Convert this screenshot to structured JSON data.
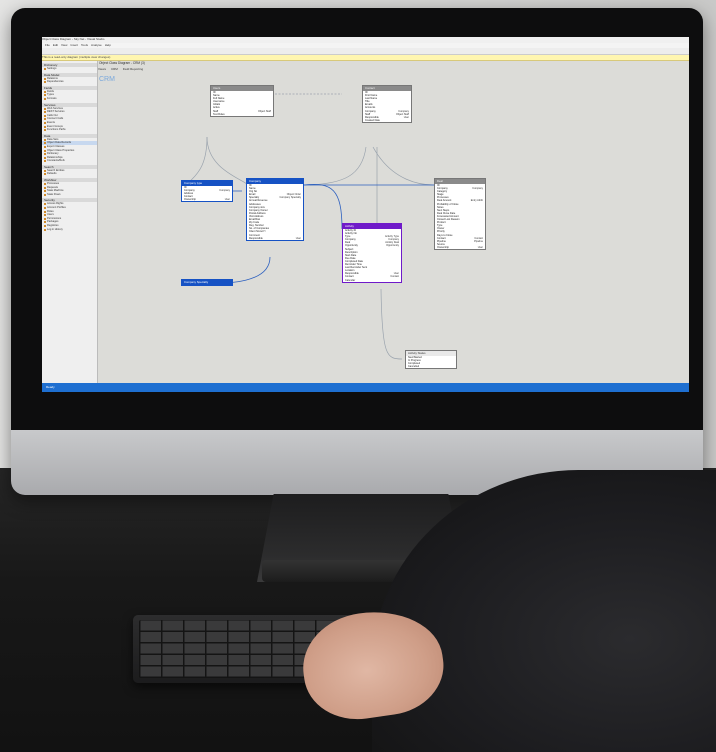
{
  "screen": {
    "title": "Object Class Diagram - Sky Net - Visual Studio",
    "menu": [
      "File",
      "Edit",
      "View",
      "Insert",
      "Tools",
      "Analyse",
      "Help"
    ],
    "infobar": "This is a read-only diagram (multiple view changes)",
    "doc_title": "Object Class Diagram - CRM (3)",
    "tabs": [
      "Views",
      "CRM",
      "Field Reporting"
    ],
    "canvas_title": "CRM",
    "statusbar": "Ready",
    "sidebar": [
      {
        "heading": "Dictionary",
        "items": [
          "Settings"
        ]
      },
      {
        "heading": "Data Model",
        "items": [
          "Relations",
          "Dependencies"
        ]
      },
      {
        "heading": "Fields",
        "items": [
          "Fields",
          "Types",
          "Formats"
        ]
      },
      {
        "heading": "Services",
        "items": [
          "Web Services",
          "REST Services",
          "Calls Out",
          "Connect Calls",
          "Events",
          "Event Groups",
          "Functions Paths"
        ]
      },
      {
        "heading": "Data",
        "items": [
          "Data Sets",
          "Object Data Records",
          "Export Classes",
          "Object Class Properties",
          "Dictionary",
          "Relationships",
          "Constants/Refs"
        ]
      },
      {
        "heading": "Search",
        "items": [
          "Search Entities",
          "Defaults"
        ]
      },
      {
        "heading": "Workflow",
        "items": [
          "Processes",
          "Requests",
          "State Machine",
          "State Flows"
        ]
      },
      {
        "heading": "Security",
        "items": [
          "Access Rights",
          "Account Profiles",
          "Roles",
          "Users",
          "Permissions",
          "Packages",
          "Registries",
          "Log in History"
        ]
      }
    ]
  },
  "boxes": {
    "topleft": {
      "header": "Users",
      "rows": [
        [
          "ID",
          ""
        ],
        [
          "Name",
          ""
        ],
        [
          "Full Name",
          ""
        ],
        [
          "Username",
          ""
        ],
        [
          "Initials",
          ""
        ],
        [
          "Active",
          ""
        ],
        [
          "Staff",
          "Object Staff"
        ],
        [
          "Test Roles",
          ""
        ]
      ]
    },
    "topright": {
      "header": "Contact",
      "rows": [
        [
          "ID",
          ""
        ],
        [
          "First Name",
          ""
        ],
        [
          "Last Name",
          ""
        ],
        [
          "Title",
          ""
        ],
        [
          "Emails",
          ""
        ],
        [
          "Accounts",
          ""
        ],
        [
          "Company",
          "Company"
        ],
        [
          "Staff",
          "Object Staff"
        ],
        [
          "Responsible",
          "User"
        ],
        [
          "Created Date",
          ""
        ]
      ]
    },
    "left": {
      "header": "Company type",
      "rows": [
        [
          "ID",
          ""
        ],
        [
          "Company",
          "Company"
        ],
        [
          "Address",
          ""
        ],
        [
          "Contact",
          ""
        ],
        [
          "Ownership",
          "User"
        ]
      ]
    },
    "center": {
      "header": "Company",
      "rows": [
        [
          "ID",
          ""
        ],
        [
          "Name",
          ""
        ],
        [
          "Org No",
          ""
        ],
        [
          "Email",
          "Object Order"
        ],
        [
          "Specialty",
          "Company Specialty"
        ],
        [
          "Annual Revenue",
          ""
        ],
        [
          "Addresses",
          ""
        ],
        [
          "Company size",
          ""
        ],
        [
          "Company Owner",
          ""
        ],
        [
          "Postal Address",
          ""
        ],
        [
          "Visit Address",
          ""
        ],
        [
          "Email/Fax",
          ""
        ],
        [
          "Zip Code",
          ""
        ],
        [
          "Reg. Number",
          ""
        ],
        [
          "No. of Companies",
          ""
        ],
        [
          "Client Since/Yr",
          ""
        ],
        [
          "Comment",
          ""
        ],
        [
          "Responsible",
          "User"
        ]
      ]
    },
    "bottomleft": {
      "header": "Company Specialty",
      "rows": []
    },
    "right": {
      "header": "Deal",
      "rows": [
        [
          "ID",
          ""
        ],
        [
          "Company",
          "Company"
        ],
        [
          "Category",
          ""
        ],
        [
          "Stage",
          ""
        ],
        [
          "Processes",
          ""
        ],
        [
          "Deal Amount",
          "Entry Attrib"
        ],
        [
          "Probability of Close",
          ""
        ],
        [
          "Notes",
          ""
        ],
        [
          "Next Steps",
          ""
        ],
        [
          "Deal Close Date",
          ""
        ],
        [
          "Forecasted Amount",
          ""
        ],
        [
          "Closed Lost Reason",
          ""
        ],
        [
          "Product",
          ""
        ],
        [
          "Type",
          ""
        ],
        [
          "Owner",
          ""
        ],
        [
          "Priority",
          ""
        ],
        [
          "Days to Close",
          ""
        ],
        [
          "Contact",
          "Contact"
        ],
        [
          "Pipeline",
          "Pipeline"
        ],
        [
          "Source",
          ""
        ],
        [
          "Ownership",
          "User"
        ]
      ]
    },
    "middle": {
      "header": "Activity",
      "rows": [
        [
          "Activity ID",
          ""
        ],
        [
          "Activity No",
          ""
        ],
        [
          "Type",
          "Activity Type"
        ],
        [
          "Company",
          "Company"
        ],
        [
          "Deal",
          "Activity Deal"
        ],
        [
          "Opportunity",
          "Opportunity"
        ],
        [
          "Subject",
          ""
        ],
        [
          "Description",
          ""
        ],
        [
          "Start Date",
          ""
        ],
        [
          "Due Date",
          ""
        ],
        [
          "Completed Date",
          ""
        ],
        [
          "Reminder Time",
          ""
        ],
        [
          "Last Reminder Sent",
          ""
        ],
        [
          "Location",
          ""
        ],
        [
          "Responsible",
          "User"
        ],
        [
          "Contact",
          "Contact"
        ],
        [
          "Calendar",
          ""
        ]
      ]
    },
    "bottomright": {
      "header": "Activity Status",
      "rows": [
        [
          "New/Started",
          ""
        ],
        [
          "In Progress",
          ""
        ],
        [
          "Completed",
          ""
        ],
        [
          "Cancelled",
          ""
        ]
      ]
    }
  },
  "colors": {
    "gray_header": "#8a8a8a",
    "blue_header": "#1652c4",
    "purple_header": "#6f1ac9",
    "status_bar": "#1e6fd1"
  },
  "icons": [
    "gear-icon",
    "folder-icon"
  ]
}
